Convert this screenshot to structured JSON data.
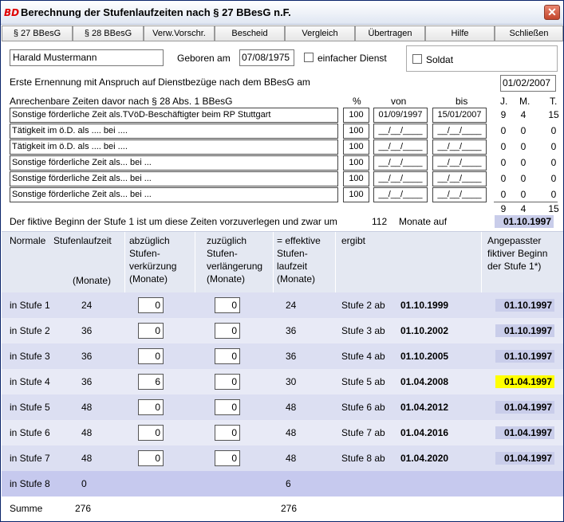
{
  "window": {
    "title": "Berechnung der Stufenlaufzeiten nach § 27 BBesG n.F.",
    "icon": "app-logo-icon",
    "close_label": "✕"
  },
  "menu": [
    "§ 27 BBesG",
    "§ 28 BBesG",
    "Verw.Vorschr.",
    "Bescheid",
    "Vergleich",
    "Übertragen",
    "Hilfe",
    "Schließen"
  ],
  "person": {
    "name": "Harald Mustermann",
    "geboren_label": "Geboren am",
    "geboren_value": "07/08/1975",
    "einfacher_dienst_label": "einfacher Dienst",
    "soldat_label": "Soldat"
  },
  "ernennung": {
    "label": "Erste Ernennung mit Anspruch auf Dienstbezüge nach dem BBesG am",
    "value": "01/02/2007"
  },
  "zeiten": {
    "header": "Anrechenbare Zeiten davor nach § 28 Abs. 1 BBesG",
    "col_pct": "%",
    "col_von": "von",
    "col_bis": "bis",
    "col_j": "J.",
    "col_m": "M.",
    "col_t": "T.",
    "rows": [
      {
        "text": "Sonstige förderliche Zeit als.TVöD-Beschäftigter beim RP Stuttgart",
        "pct": "100",
        "von": "01/09/1997",
        "bis": "15/01/2007",
        "j": "9",
        "m": "4",
        "t": "15"
      },
      {
        "text": "Tätigkeit im ö.D. als .... bei ....",
        "pct": "100",
        "von": "__/__/____",
        "bis": "__/__/____",
        "j": "0",
        "m": "0",
        "t": "0"
      },
      {
        "text": "Tätigkeit im ö.D. als .... bei ....",
        "pct": "100",
        "von": "__/__/____",
        "bis": "__/__/____",
        "j": "0",
        "m": "0",
        "t": "0"
      },
      {
        "text": "Sonstige förderliche Zeit als... bei ...",
        "pct": "100",
        "von": "__/__/____",
        "bis": "__/__/____",
        "j": "0",
        "m": "0",
        "t": "0"
      },
      {
        "text": "Sonstige förderliche Zeit als... bei ...",
        "pct": "100",
        "von": "__/__/____",
        "bis": "__/__/____",
        "j": "0",
        "m": "0",
        "t": "0"
      },
      {
        "text": "Sonstige förderliche Zeit als... bei ...",
        "pct": "100",
        "von": "__/__/____",
        "bis": "__/__/____",
        "j": "0",
        "m": "0",
        "t": "0"
      }
    ],
    "sum": {
      "j": "9",
      "m": "4",
      "t": "15"
    }
  },
  "fiktiv": {
    "text": "Der fiktive Beginn der Stufe 1 ist um diese Zeiten vorzuverlegen und zwar um",
    "months": "112",
    "monate_auf": "Monate auf",
    "date": "01.10.1997"
  },
  "table_header": {
    "normale": "Normale",
    "stufenlaufzeit": "Stufenlaufzeit",
    "monate": "(Monate)",
    "abzueglich": [
      "abzüglich",
      "Stufen-",
      "verkürzung",
      "(Monate)"
    ],
    "zuzueglich": [
      "zuzüglich",
      "Stufen-",
      "verlängerung",
      "(Monate)"
    ],
    "effektiv": [
      "= effektive",
      "Stufen-",
      "laufzeit",
      "(Monate)"
    ],
    "ergibt": "ergibt",
    "angepasst": [
      "Angepasster",
      "fiktiver Beginn",
      "der Stufe 1*)"
    ]
  },
  "stufen": [
    {
      "label": "in Stufe 1",
      "laufzeit": "24",
      "abz": "0",
      "zuz": "0",
      "eff": "24",
      "ergibt": "Stufe 2 ab",
      "date": "01.10.1999",
      "angepasst": "01.10.1997",
      "highlight": false
    },
    {
      "label": "in Stufe 2",
      "laufzeit": "36",
      "abz": "0",
      "zuz": "0",
      "eff": "36",
      "ergibt": "Stufe 3 ab",
      "date": "01.10.2002",
      "angepasst": "01.10.1997",
      "highlight": false
    },
    {
      "label": "in Stufe 3",
      "laufzeit": "36",
      "abz": "0",
      "zuz": "0",
      "eff": "36",
      "ergibt": "Stufe 4 ab",
      "date": "01.10.2005",
      "angepasst": "01.10.1997",
      "highlight": false
    },
    {
      "label": "in Stufe 4",
      "laufzeit": "36",
      "abz": "6",
      "zuz": "0",
      "eff": "30",
      "ergibt": "Stufe 5 ab",
      "date": "01.04.2008",
      "angepasst": "01.04.1997",
      "highlight": true
    },
    {
      "label": "in Stufe 5",
      "laufzeit": "48",
      "abz": "0",
      "zuz": "0",
      "eff": "48",
      "ergibt": "Stufe 6 ab",
      "date": "01.04.2012",
      "angepasst": "01.04.1997",
      "highlight": false
    },
    {
      "label": "in Stufe 6",
      "laufzeit": "48",
      "abz": "0",
      "zuz": "0",
      "eff": "48",
      "ergibt": "Stufe 7 ab",
      "date": "01.04.2016",
      "angepasst": "01.04.1997",
      "highlight": false
    },
    {
      "label": "in Stufe 7",
      "laufzeit": "48",
      "abz": "0",
      "zuz": "0",
      "eff": "48",
      "ergibt": "Stufe 8 ab",
      "date": "01.04.2020",
      "angepasst": "01.04.1997",
      "highlight": false
    },
    {
      "label": "in Stufe 8",
      "laufzeit": "0",
      "eff": "6"
    }
  ],
  "summe": {
    "label": "Summe",
    "laufzeit": "276",
    "eff": "276"
  },
  "colors": {
    "row_a": "#dcdff2",
    "row_b": "#e8eaf6",
    "row_last": "#c6c9ee",
    "highlight": "#ffff00",
    "date_bg": "#c9cdea"
  }
}
